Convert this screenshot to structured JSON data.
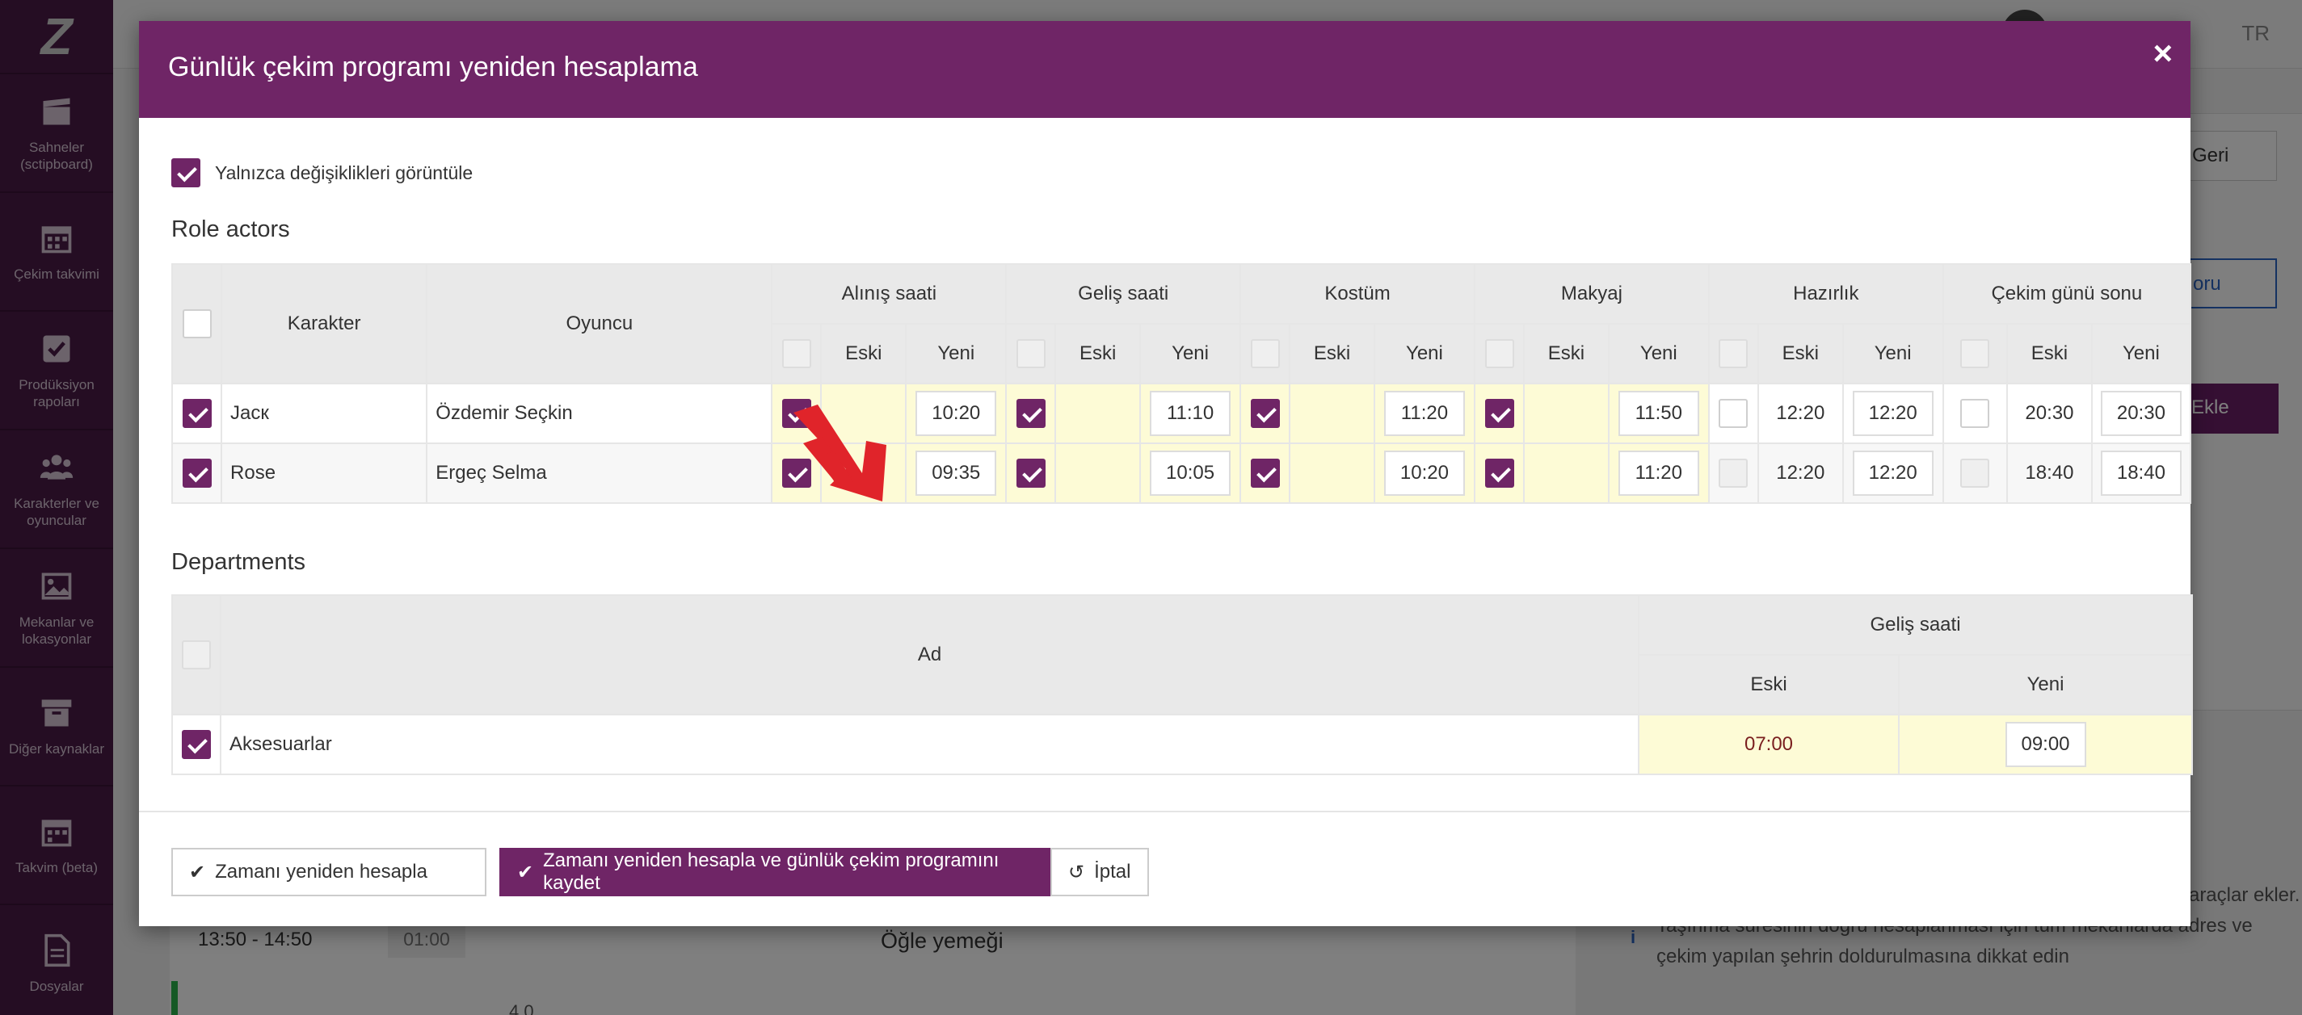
{
  "sidebar": {
    "logo": "Z",
    "items": [
      {
        "label": "Sahneler (sctipboard)",
        "icon": "clapperboard-icon"
      },
      {
        "label": "Çekim takvimi",
        "icon": "calendar-icon"
      },
      {
        "label": "Prodüksiyon rapoları",
        "icon": "checkbox-icon"
      },
      {
        "label": "Karakterler ve oyuncular",
        "icon": "people-icon"
      },
      {
        "label": "Mekanlar ve lokasyonlar",
        "icon": "image-icon"
      },
      {
        "label": "Diğer kaynaklar",
        "icon": "archive-icon"
      },
      {
        "label": "Takvim (beta)",
        "icon": "calendar-icon"
      },
      {
        "label": "Dosyalar",
        "icon": "file-icon"
      }
    ]
  },
  "background": {
    "lang": "TR",
    "btn_geri": "Geri",
    "btn_blue": "oru",
    "btn_ekle": "Ekle",
    "row_time": "13:50 - 14:50",
    "row_duration": "01:00",
    "row_title": "Öğle yemeği",
    "row_number": "4.0",
    "info_text": "olarak hesaba katar ve trafik sıkışıklığını dikkate alarak teknik araçlar ekler. Taşınma süresinin doğru hesaplanması için tüm mekanlarda adres ve çekim yapılan şehrin doldurulmasına dikkat edin"
  },
  "modal": {
    "title": "Günlük çekim programı yeniden hesaplama",
    "close_label": "×",
    "filter_label": "Yalnızca değişiklikleri görüntüle",
    "filter_checked": true,
    "roles": {
      "section_title": "Role actors",
      "col_character": "Karakter",
      "col_actor": "Oyuncu",
      "col_old": "Eski",
      "col_new": "Yeni",
      "groups": [
        "Alınış saati",
        "Geliş saati",
        "Kostüm",
        "Makyaj",
        "Hazırlık",
        "Çekim günü sonu"
      ],
      "rows": [
        {
          "character": "Jacк",
          "actor": "Özdemir Seçkin",
          "values": [
            {
              "checked": true,
              "old": "",
              "new": "10:20"
            },
            {
              "checked": true,
              "old": "",
              "new": "11:10"
            },
            {
              "checked": true,
              "old": "",
              "new": "11:20"
            },
            {
              "checked": true,
              "old": "",
              "new": "11:50"
            },
            {
              "checked": false,
              "old": "12:20",
              "new": "12:20"
            },
            {
              "checked": false,
              "old": "20:30",
              "new": "20:30"
            }
          ]
        },
        {
          "character": "Rose",
          "actor": "Ergeç Selma",
          "values": [
            {
              "checked": true,
              "old": "",
              "new": "09:35"
            },
            {
              "checked": true,
              "old": "",
              "new": "10:05"
            },
            {
              "checked": true,
              "old": "",
              "new": "10:20"
            },
            {
              "checked": true,
              "old": "",
              "new": "11:20"
            },
            {
              "checked": false,
              "old": "12:20",
              "new": "12:20"
            },
            {
              "checked": false,
              "old": "18:40",
              "new": "18:40"
            }
          ]
        }
      ]
    },
    "departments": {
      "section_title": "Departments",
      "col_name": "Ad",
      "col_group": "Geliş saati",
      "col_old": "Eski",
      "col_new": "Yeni",
      "rows": [
        {
          "name": "Aksesuarlar",
          "old": "07:00",
          "new": "09:00",
          "checked": true
        }
      ]
    },
    "footer": {
      "btn_recalc": "Zamanı yeniden hesapla",
      "btn_recalc_save": "Zamanı yeniden hesapla ve günlük çekim programını kaydet",
      "btn_cancel": "İptal"
    }
  },
  "colors": {
    "primary": "#6f2566",
    "highlight": "#fdfbd6",
    "arrow": "#e0242a"
  }
}
